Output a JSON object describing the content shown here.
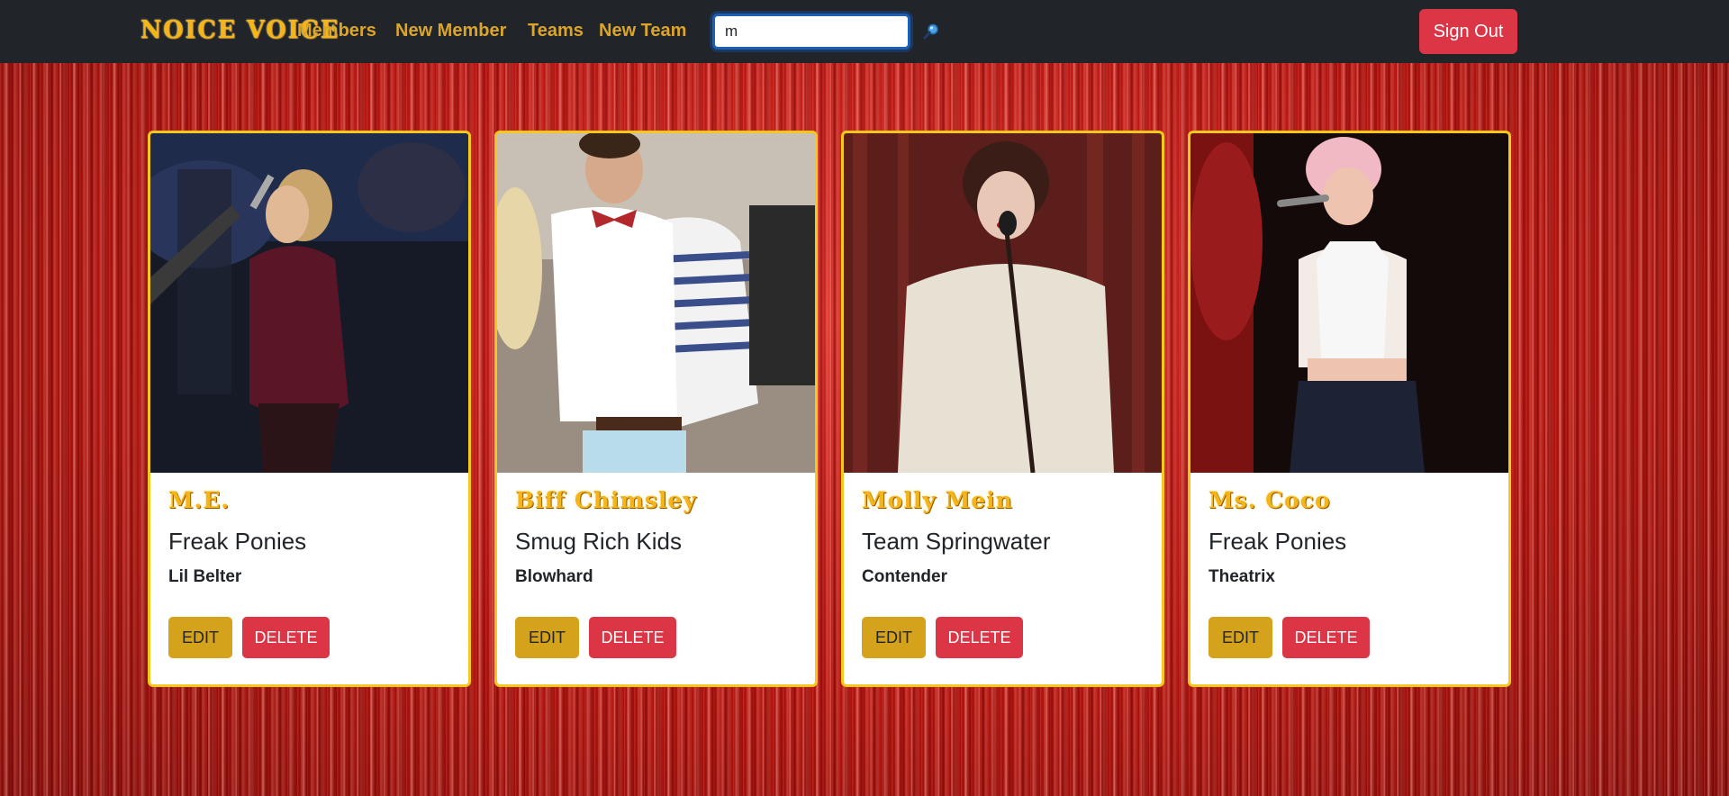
{
  "navbar": {
    "brand": "NOICE VOICE",
    "links": [
      "Members",
      "New Member",
      "Teams",
      "New Team"
    ],
    "search": {
      "value": "m",
      "icon": "magnifier-icon"
    },
    "sign_out": "Sign Out"
  },
  "colors": {
    "nav_bg": "#212529",
    "gold": "#dba52b",
    "danger": "#dc3545",
    "warning": "#d4a21b",
    "card_border": "#f6c81d"
  },
  "cards": [
    {
      "name": "M.E.",
      "team": "Freak Ponies",
      "nickname": "Lil Belter",
      "edit": "EDIT",
      "delete": "DELETE"
    },
    {
      "name": "Biff Chimsley",
      "team": "Smug Rich Kids",
      "nickname": "Blowhard",
      "edit": "EDIT",
      "delete": "DELETE"
    },
    {
      "name": "Molly Mein",
      "team": "Team Springwater",
      "nickname": "Contender",
      "edit": "EDIT",
      "delete": "DELETE"
    },
    {
      "name": "Ms. Coco",
      "team": "Freak Ponies",
      "nickname": "Theatrix",
      "edit": "EDIT",
      "delete": "DELETE"
    }
  ]
}
